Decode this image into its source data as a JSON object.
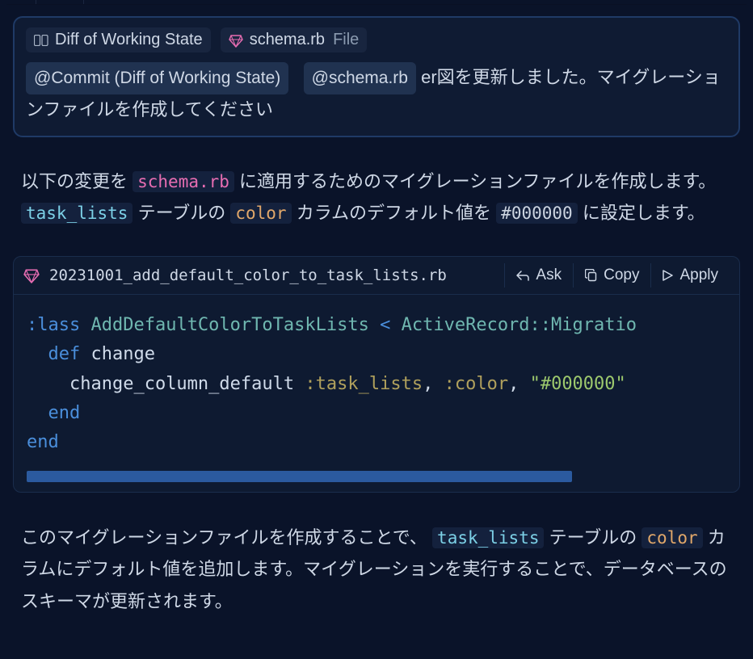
{
  "prompt": {
    "chips": [
      {
        "icon": "diff",
        "label": "Diff of Working State",
        "tail": ""
      },
      {
        "icon": "ruby",
        "label": "schema.rb",
        "tail": "File"
      }
    ],
    "mentions": {
      "commit": "@Commit (Diff of Working State)",
      "schema": "@schema.rb"
    },
    "text_after_schema": " er図を更新しました。マイグレーションファイルを作成してください"
  },
  "response": {
    "p1_a": "以下の変更を ",
    "p1_schema": "schema.rb",
    "p1_b": " に適用するためのマイグレーションファイルを作成します。 ",
    "p1_table": "task_lists",
    "p1_c": " テーブルの ",
    "p1_col": "color",
    "p1_d": " カラムのデフォルト値を ",
    "p1_val": "#000000",
    "p1_e": " に設定します。"
  },
  "code": {
    "filename": "20231001_add_default_color_to_task_lists.rb",
    "actions": {
      "ask": "Ask",
      "copy": "Copy",
      "apply": "Apply"
    },
    "tokens": {
      "class_kw": ":lass",
      "class_name": "AddDefaultColorToTaskLists",
      "inherit": "ActiveRecord::Migratio",
      "lt": "<",
      "def_kw": "def",
      "method": "change",
      "call": "change_column_default",
      "arg1": ":task_lists",
      "arg2": ":color",
      "comma": ",",
      "arg3": "\"#000000\"",
      "end1": "end",
      "end2": "end"
    }
  },
  "para2": {
    "a": "このマイグレーションファイルを作成することで、 ",
    "table": "task_lists",
    "b": " テーブルの ",
    "col": "color",
    "c": " カラムにデフォルト値を追加します。マイグレーションを実行することで、データベースのスキーマが更新されます。"
  }
}
